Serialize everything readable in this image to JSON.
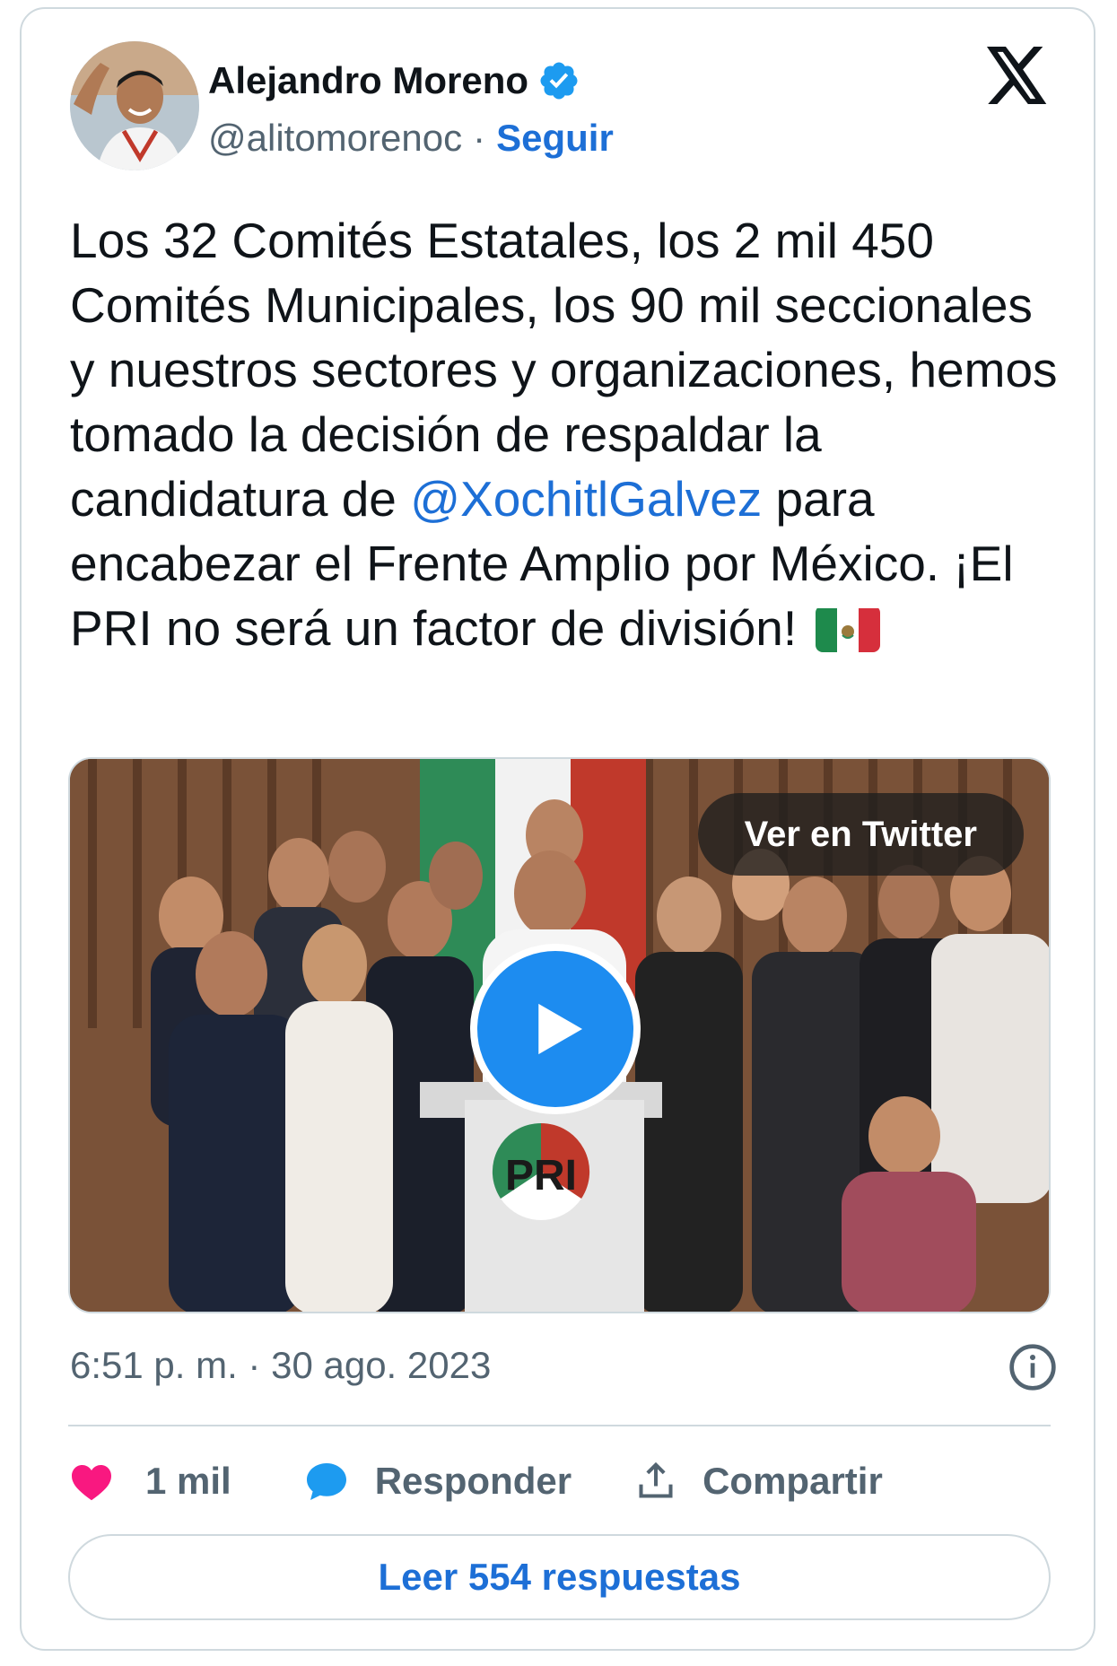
{
  "author": {
    "display_name": "Alejandro Moreno",
    "handle": "@alitomorenoc",
    "separator": "·",
    "follow_label": "Seguir",
    "verified_icon": "verified-badge-icon",
    "brand_icon": "x-logo-icon"
  },
  "tweet": {
    "text_before": "Los 32 Comités Estatales, los 2 mil 450 Comités Municipales, los 90 mil seccionales y nuestros sectores y organizaciones, hemos tomado la decisión de respaldar la candidatura de ",
    "mention": "@XochitlGalvez",
    "text_after": " para encabezar el Frente Amplio por México. ¡El PRI no será un factor de división! ",
    "emoji": "mexico-flag-emoji"
  },
  "media": {
    "view_label": "Ver en Twitter",
    "play_icon": "play-icon",
    "podium_logo": "PRI"
  },
  "meta": {
    "timestamp": "6:51 p. m. · 30 ago. 2023",
    "info_icon": "info-icon"
  },
  "actions": {
    "like_count": "1 mil",
    "reply_label": "Responder",
    "share_label": "Compartir",
    "read_replies_label": "Leer 554 respuestas"
  },
  "colors": {
    "link_blue": "#1d6fd6",
    "heart_pink": "#f91880",
    "reply_blue": "#1d9bf0",
    "muted_gray": "#536471",
    "border_gray": "#cfd9de"
  }
}
